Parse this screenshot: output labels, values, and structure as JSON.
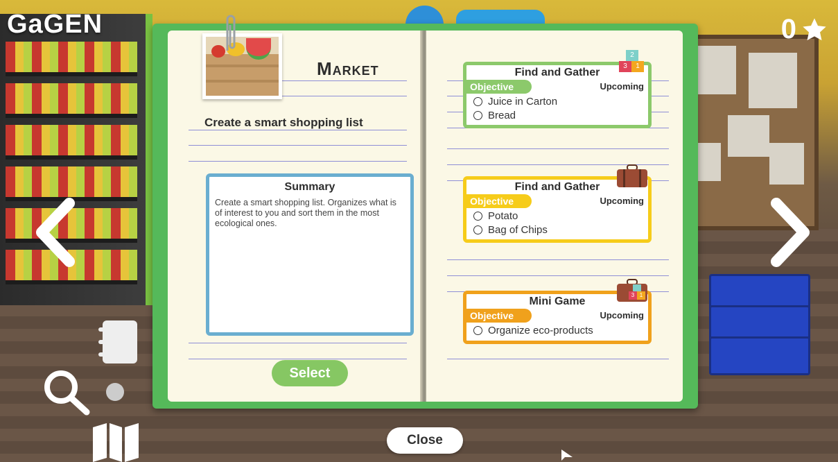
{
  "brand": "GaGEN",
  "score": "0",
  "colors": {
    "notebook_green": "#55b95a",
    "summary_border": "#6aaed0",
    "card_green": "#8cc96b",
    "card_yellow": "#f6cc1a",
    "card_orange": "#f0a11c",
    "select_button": "#86c763"
  },
  "left_page": {
    "title": "Market",
    "subtitle": "Create a smart shopping list",
    "summary": {
      "heading": "Summary",
      "text": "Create a smart shopping list. Organizes what is of interest to you and sort them in the most ecological ones."
    },
    "select_label": "Select"
  },
  "quests": [
    {
      "title": "Find and Gather",
      "objective_label": "Objective",
      "status": "Upcoming",
      "items": [
        "Juice in Carton",
        "Bread"
      ],
      "badge": [
        "2",
        "3",
        "1"
      ],
      "color": "green"
    },
    {
      "title": "Find and Gather",
      "objective_label": "Objective",
      "status": "Upcoming",
      "items": [
        "Potato",
        "Bag of Chips"
      ],
      "color": "yellow"
    },
    {
      "title": "Mini Game",
      "objective_label": "Objective",
      "status": "Upcoming",
      "items": [
        "Organize eco-products"
      ],
      "badge": [
        "3",
        "1"
      ],
      "color": "orange"
    }
  ],
  "close_label": "Close",
  "icons": {
    "star": "star-icon",
    "left": "chevron-left-icon",
    "right": "chevron-right-icon",
    "journal": "notebook-icon",
    "search": "search-icon",
    "map": "map-icon",
    "briefcase": "briefcase-icon"
  }
}
